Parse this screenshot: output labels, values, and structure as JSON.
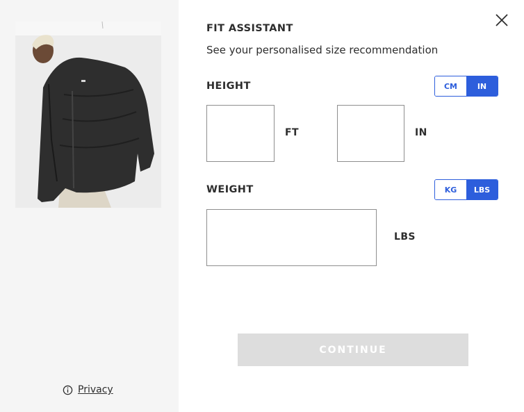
{
  "header": {
    "title": "FIT ASSISTANT",
    "subtitle": "See your personalised size recommendation"
  },
  "icons": {
    "close": "close-icon",
    "privacy": "info-icon"
  },
  "sidebar": {
    "privacy_label": "Privacy"
  },
  "height": {
    "label": "HEIGHT",
    "units": [
      "CM",
      "IN"
    ],
    "selected_unit": "IN",
    "feet_value": "",
    "feet_unit": "FT",
    "inches_value": "",
    "inches_unit": "IN"
  },
  "weight": {
    "label": "WEIGHT",
    "units": [
      "KG",
      "LBS"
    ],
    "selected_unit": "LBS",
    "value": "",
    "unit": "LBS"
  },
  "actions": {
    "continue_label": "CONTINUE",
    "continue_enabled": false
  },
  "colors": {
    "accent": "#2d5edc",
    "text": "#2d2d2d",
    "sidebar_bg": "#f5f5f5",
    "button_disabled": "#dddddd"
  }
}
